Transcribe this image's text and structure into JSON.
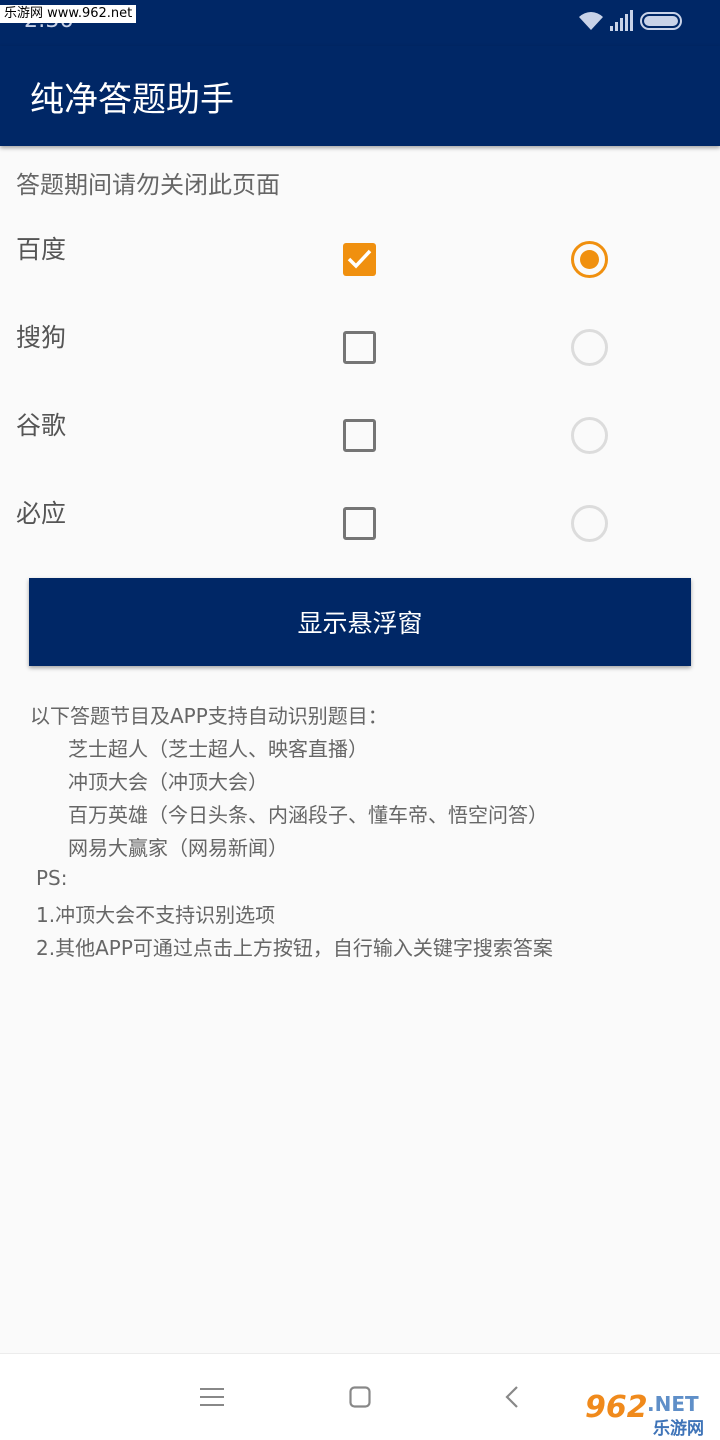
{
  "status_bar": {
    "time": "2:36",
    "watermark": "乐游网 www.962.net",
    "icons": [
      "wifi-icon",
      "signal-icon",
      "battery-icon"
    ]
  },
  "app_bar": {
    "title": "纯净答题助手"
  },
  "note": "答题期间请勿关闭此页面",
  "engines": [
    {
      "label": "百度",
      "checked": true,
      "selected": true
    },
    {
      "label": "搜狗",
      "checked": false,
      "selected": false
    },
    {
      "label": "谷歌",
      "checked": false,
      "selected": false
    },
    {
      "label": "必应",
      "checked": false,
      "selected": false
    }
  ],
  "float_button": {
    "label": "显示悬浮窗"
  },
  "info": {
    "heading": "以下答题节目及APP支持自动识别题目：",
    "programs": [
      "芝士超人（芝士超人、映客直播）",
      "冲顶大会（冲顶大会）",
      "百万英雄（今日头条、内涵段子、懂车帝、悟空问答）",
      "网易大赢家（网易新闻）"
    ],
    "ps_label": "PS:",
    "ps_notes": [
      "1.冲顶大会不支持识别选项",
      "2.其他APP可通过点击上方按钮，自行输入关键字搜索答案"
    ]
  },
  "nav_bar": {
    "icons": [
      "menu-icon",
      "home-icon",
      "back-icon"
    ]
  },
  "site_watermark": {
    "number": "962",
    "domain": ".NET",
    "name": "乐游网"
  },
  "colors": {
    "primary": "#002766",
    "accent": "#f0900f",
    "background": "#fafafa"
  }
}
